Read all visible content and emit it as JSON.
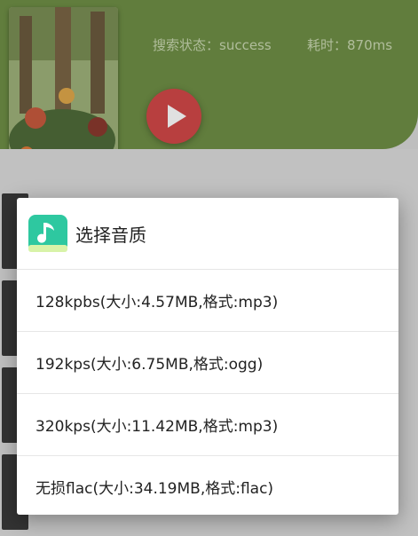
{
  "background": {
    "search_status": "搜索状态：success",
    "elapsed_time": "耗时：870ms"
  },
  "dialog": {
    "icon": "music-note-icon",
    "title": "选择音质",
    "options": [
      {
        "label": "128kpbs(大小:4.57MB,格式:mp3)"
      },
      {
        "label": "192kps(大小:6.75MB,格式:ogg)"
      },
      {
        "label": "320kps(大小:11.42MB,格式:mp3)"
      },
      {
        "label": "无损flac(大小:34.19MB,格式:flac)"
      }
    ]
  },
  "colors": {
    "header_green": "#6f8f46",
    "play_red": "#d24848",
    "icon_teal": "#2ec8a0"
  }
}
